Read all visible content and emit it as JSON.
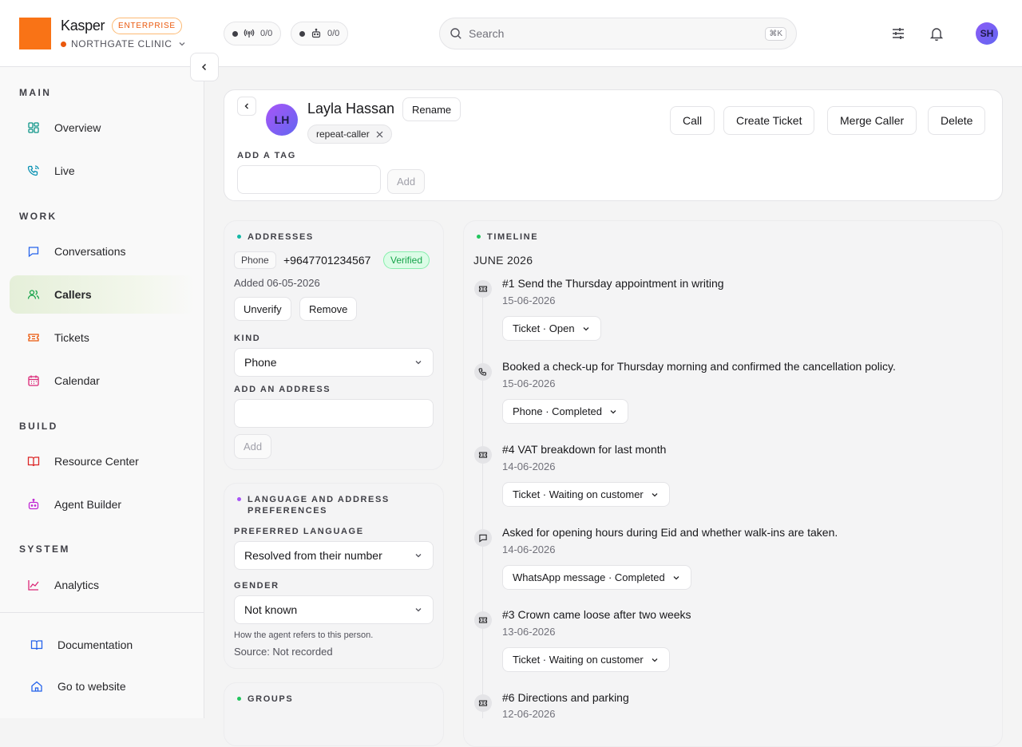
{
  "brand": {
    "name": "Kasper",
    "plan": "ENTERPRISE",
    "org": "NORTHGATE CLINIC"
  },
  "counters": [
    {
      "icon": "antenna-icon",
      "value": "0/0"
    },
    {
      "icon": "bot-icon",
      "value": "0/0"
    }
  ],
  "search": {
    "placeholder": "Search",
    "shortcut": "⌘K"
  },
  "user": {
    "initials": "SH"
  },
  "sidebar": {
    "sections": {
      "main": "MAIN",
      "work": "WORK",
      "build": "BUILD",
      "system": "SYSTEM"
    },
    "items": [
      {
        "label": "Overview",
        "icon": "grid-icon"
      },
      {
        "label": "Live",
        "icon": "phone-call-icon"
      },
      {
        "label": "Conversations",
        "icon": "message-square-icon"
      },
      {
        "label": "Callers",
        "icon": "users-icon",
        "active": true
      },
      {
        "label": "Tickets",
        "icon": "ticket-icon"
      },
      {
        "label": "Calendar",
        "icon": "calendar-icon"
      },
      {
        "label": "Resource Center",
        "icon": "book-open-icon"
      },
      {
        "label": "Agent Builder",
        "icon": "bot-icon"
      },
      {
        "label": "Analytics",
        "icon": "line-chart-icon"
      }
    ],
    "footer": [
      {
        "label": "Documentation",
        "icon": "book-icon"
      },
      {
        "label": "Go to website",
        "icon": "home-icon"
      }
    ]
  },
  "caller": {
    "initials": "LH",
    "name": "Layla Hassan",
    "rename": "Rename",
    "tags": [
      "repeat-caller"
    ],
    "add_tag_label": "ADD A TAG",
    "add_tag_value": "",
    "add_button": "Add",
    "actions": [
      "Call",
      "Create Ticket",
      "Merge Caller",
      "Delete"
    ]
  },
  "addresses": {
    "title": "ADDRESSES",
    "type": "Phone",
    "number": "+9647701234567",
    "status": "Verified",
    "added": "Added 06-05-2026",
    "unverify": "Unverify",
    "remove": "Remove",
    "kind_label": "KIND",
    "kind_value": "Phone",
    "add_label": "ADD AN ADDRESS",
    "add_value": "",
    "add_button": "Add"
  },
  "preferences": {
    "title": "LANGUAGE AND ADDRESS PREFERENCES",
    "language_label": "PREFERRED LANGUAGE",
    "language_value": "Resolved from their number",
    "gender_label": "GENDER",
    "gender_value": "Not known",
    "hint": "How the agent refers to this person.",
    "source": "Source: Not recorded"
  },
  "groups": {
    "title": "GROUPS"
  },
  "timeline": {
    "title": "TIMELINE",
    "month": "JUNE 2026",
    "events": [
      {
        "icon": "ticket-icon",
        "title": "#1 Send the Thursday appointment in writing",
        "date": "15-06-2026",
        "status": "Ticket · Open"
      },
      {
        "icon": "phone-icon",
        "title": "Booked a check-up for Thursday morning and confirmed the cancellation policy.",
        "date": "15-06-2026",
        "status": "Phone · Completed"
      },
      {
        "icon": "ticket-icon",
        "title": "#4 VAT breakdown for last month",
        "date": "14-06-2026",
        "status": "Ticket · Waiting on customer"
      },
      {
        "icon": "message-square-icon",
        "title": "Asked for opening hours during Eid and whether walk-ins are taken.",
        "date": "14-06-2026",
        "status": "WhatsApp message · Completed"
      },
      {
        "icon": "ticket-icon",
        "title": "#3 Crown came loose after two weeks",
        "date": "13-06-2026",
        "status": "Ticket · Waiting on customer"
      },
      {
        "icon": "ticket-icon",
        "title": "#6 Directions and parking",
        "date": "12-06-2026",
        "status": ""
      }
    ]
  },
  "colors": {
    "brand": "#f97316",
    "active_nav": "#e5efd9",
    "verified": "#16a34a",
    "addresses_dot": "#14b8a6",
    "preferences_dot": "#a855f7",
    "groups_dot": "#22c55e",
    "timeline_dot": "#22c55e"
  }
}
